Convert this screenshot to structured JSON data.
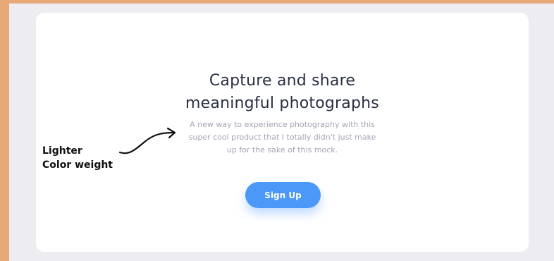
{
  "hero": {
    "headline_line1": "Capture and share",
    "headline_line2": "meaningful photographs",
    "subtext_line1": "A new way to experience photography with this",
    "subtext_line2": "super cool product that I totally didn't just make",
    "subtext_line3": "up for the sake of this mock.",
    "signup_label": "Sign Up"
  },
  "annotation": {
    "line1": "Lighter",
    "line2": "Color weight"
  },
  "colors": {
    "frame_border": "#e8a878",
    "page_background": "#ececf1",
    "card_background": "#ffffff",
    "headline_text": "#2a2f44",
    "subtext_text": "#a3a6b6",
    "button_background": "#4c98f9",
    "button_text": "#ffffff"
  }
}
